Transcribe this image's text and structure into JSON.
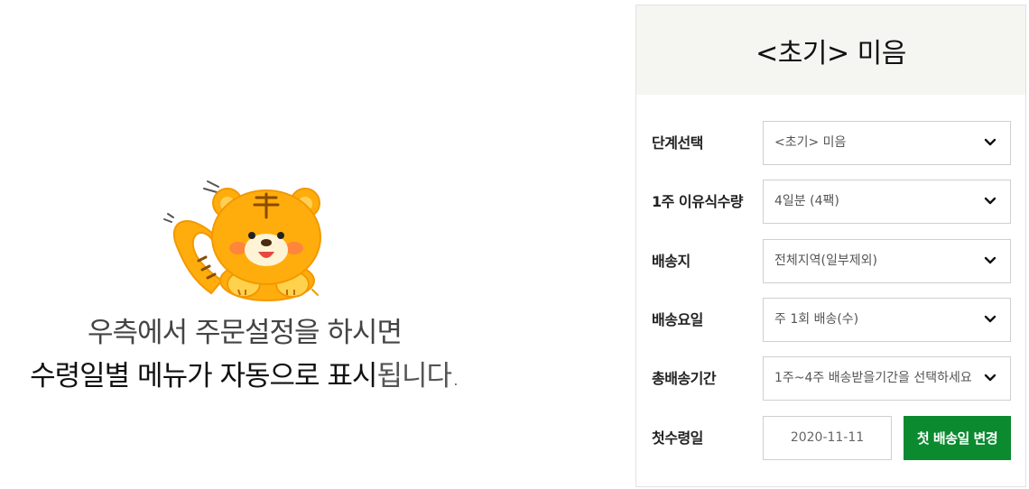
{
  "message": {
    "line1": "우측에서 주문설정을 하시면",
    "line2_strong": "수령일별 메뉴가 자동으로 표시",
    "line2_light": "됩니다."
  },
  "panel": {
    "title": "<초기> 미음",
    "rows": [
      {
        "label": "단계선택",
        "value": "<초기> 미음"
      },
      {
        "label": "1주 이유식수량",
        "value": "4일분 (4팩)"
      },
      {
        "label": "배송지",
        "value": "전체지역(일부제외)"
      },
      {
        "label": "배송요일",
        "value": "주 1회 배송(수)"
      },
      {
        "label": "총배송기간",
        "value": "1주~4주 배송받을기간을 선택하세요"
      }
    ],
    "first_date": {
      "label": "첫수령일",
      "value": "2020-11-11",
      "button": "첫 배송일 변경"
    }
  },
  "colors": {
    "accent_green": "#0b8a2f",
    "header_bg": "#f5f6f2",
    "mascot_orange": "#ffad0d"
  },
  "icons": {
    "mascot": "tiger-mascot",
    "dropdown": "chevron-down-icon"
  }
}
